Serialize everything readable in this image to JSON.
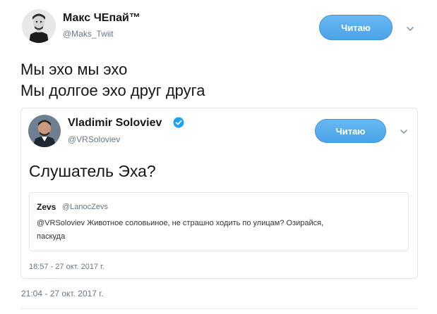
{
  "main_tweet": {
    "name": "Макс ЧЕпай™",
    "handle": "@Maks_Twiit",
    "follow_label": "Читаю",
    "text_line1": "Мы эхо мы эхо",
    "text_line2": "Мы долгое эхо друг друга",
    "timestamp": "21:04 - 27 окт. 2017 г."
  },
  "quoted_tweet": {
    "name": "Vladimir Soloviev",
    "verified": true,
    "handle": "@VRSoloviev",
    "follow_label": "Читаю",
    "text": "Слушатель Эха?",
    "timestamp": "18:57 - 27 окт. 2017 г."
  },
  "nested_quote": {
    "name": "Zevs",
    "handle": "@LanocZevs",
    "text_line1": "@VRSoloviev Животное соловьиное, не страшно ходить по улицам? Озирайся,",
    "text_line2": "паскуда"
  },
  "colors": {
    "accent": "#4aa3e8",
    "verified": "#1da1f2",
    "muted": "#657786",
    "border": "#e1e8ed"
  },
  "icons": [
    "chevron-down-icon",
    "verified-badge-icon"
  ]
}
